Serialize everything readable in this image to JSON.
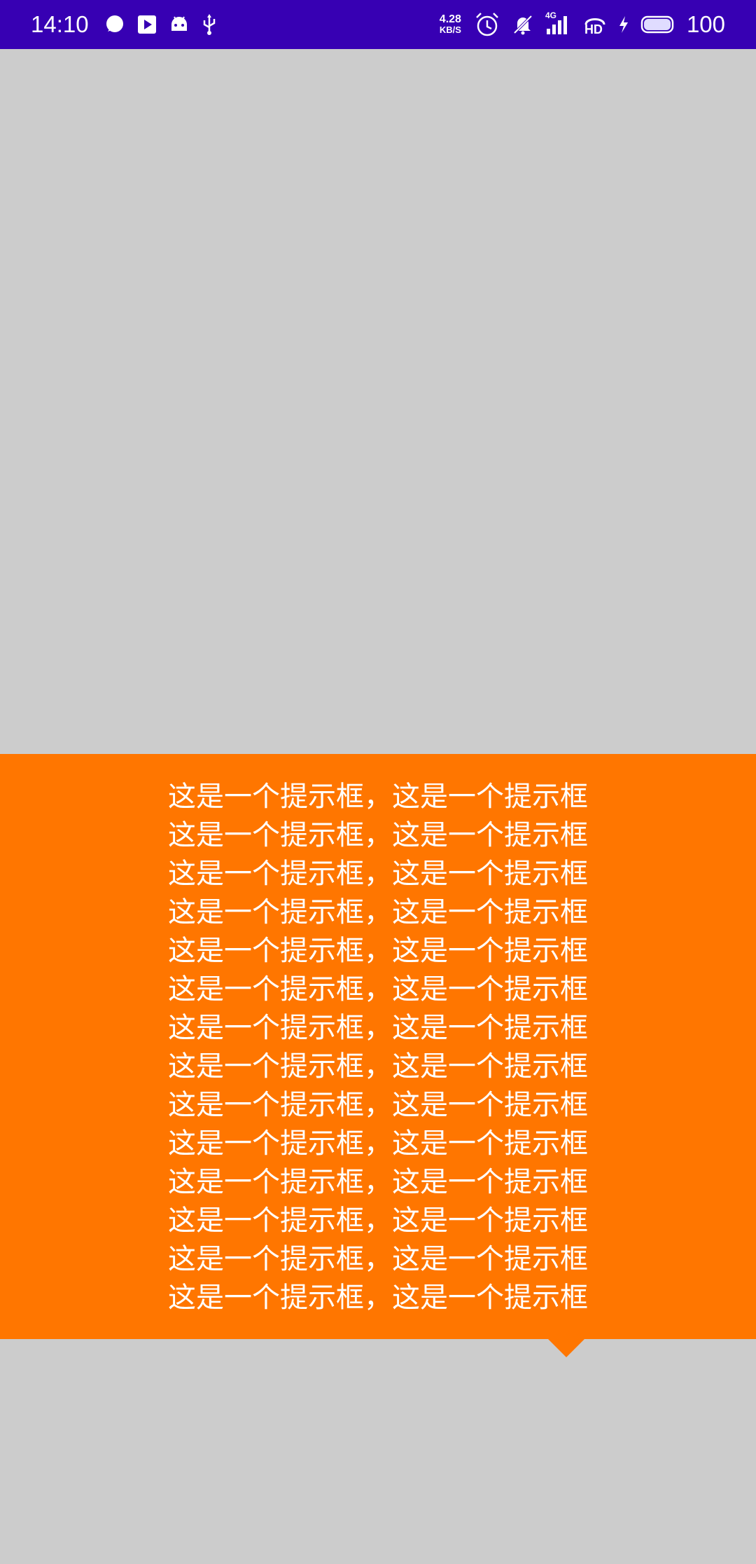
{
  "status_bar": {
    "time": "14:10",
    "net_speed_value": "4.28",
    "net_speed_unit": "KB/S",
    "signal_label": "4G",
    "hd_label": "HD",
    "battery": "100",
    "icons": [
      "chat-bubble-icon",
      "play-store-icon",
      "android-icon",
      "usb-icon",
      "alarm-icon",
      "mute-icon",
      "signal-icon",
      "hd-call-icon",
      "charging-icon",
      "battery-icon"
    ]
  },
  "tooltip": {
    "lines": [
      "这是一个提示框，这是一个提示框",
      "这是一个提示框，这是一个提示框",
      "这是一个提示框，这是一个提示框",
      "这是一个提示框，这是一个提示框",
      "这是一个提示框，这是一个提示框",
      "这是一个提示框，这是一个提示框",
      "这是一个提示框，这是一个提示框",
      "这是一个提示框，这是一个提示框",
      "这是一个提示框，这是一个提示框",
      "这是一个提示框，这是一个提示框",
      "这是一个提示框，这是一个提示框",
      "这是一个提示框，这是一个提示框",
      "这是一个提示框，这是一个提示框",
      "这是一个提示框，这是一个提示框"
    ],
    "background_color": "#ff7600",
    "text_color": "#ffffff"
  },
  "colors": {
    "status_bar": "#3700b3",
    "page_background": "#cccccc"
  }
}
